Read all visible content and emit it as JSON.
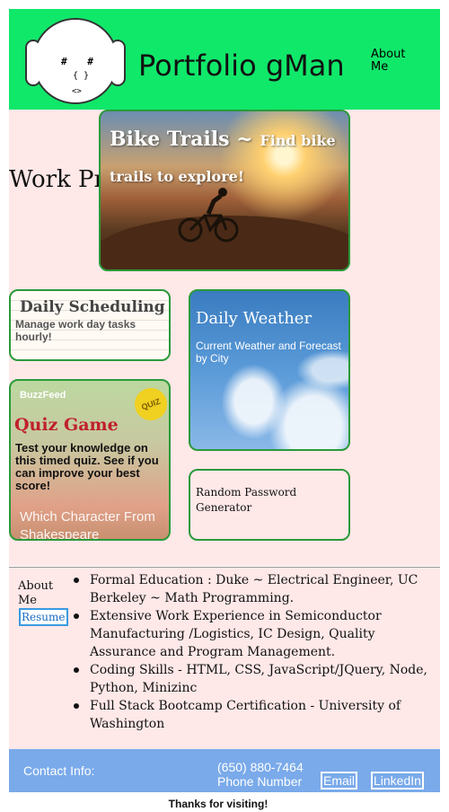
{
  "header": {
    "avatar_top": "#  #",
    "avatar_mid": "{ }",
    "avatar_bottom": "<>",
    "title": "Portfolio gMan",
    "nav_about": "About Me"
  },
  "work": {
    "heading": "Work Projects",
    "projects": [
      {
        "title": "Bike Trails ~",
        "subtitle": "Find bike trails to explore!"
      },
      {
        "title": "Daily Scheduling",
        "description": "Manage work day tasks hourly!"
      },
      {
        "title": "Daily Weather",
        "description": "Current Weather and Forecast by City"
      },
      {
        "title": "Quiz Game",
        "description": "Test your knowledge on this timed quiz. See if you can improve your best score!",
        "brand": "BuzzFeed",
        "badge": "QUIZ",
        "image_text": "Which Character From Shakespeare"
      },
      {
        "title": "Random Password Generator"
      }
    ]
  },
  "about": {
    "label": "About Me",
    "resume": "Resume",
    "items": [
      "Formal Education : Duke ~ Electrical Engineer, UC Berkeley ~ Math Programming.",
      "Extensive Work Experience in Semiconductor Manufacturing /Logistics, IC Design, Quality Assurance and Program Management.",
      "Coding Skills - HTML, CSS, JavaScript/JQuery, Node, Python, Minizinc",
      "Full Stack Bootcamp Certification - University of Washington"
    ]
  },
  "contact": {
    "label": "Contact Info:",
    "phone": "(650) 880-7464",
    "phone_label": "Phone Number",
    "email": "Email",
    "linkedin": "LinkedIn"
  },
  "footer": {
    "thanks": "Thanks for visiting!"
  },
  "colors": {
    "header_bg": "#10e86a",
    "page_bg": "#ffe8e8",
    "card_border": "#2a9a3a",
    "contact_bg": "#7aaaea"
  }
}
